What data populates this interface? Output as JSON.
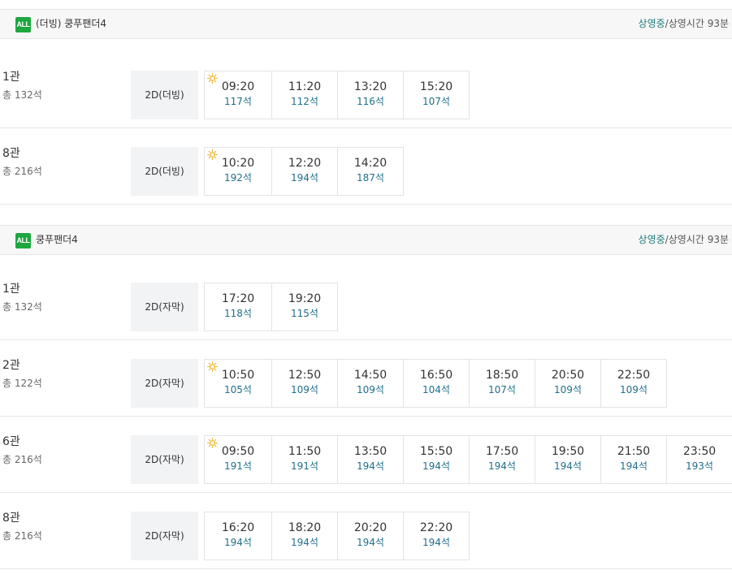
{
  "movies": [
    {
      "rating": "ALL",
      "title": "(더빙) 쿵푸팬더4",
      "status_label": "상영중",
      "runtime": "/상영시간 93분",
      "halls": [
        {
          "name": "1관",
          "seats": "총 132석",
          "format": "2D(더빙)",
          "showtimes": [
            {
              "time": "09:20",
              "seats": "117석",
              "icon": "sun-icon"
            },
            {
              "time": "11:20",
              "seats": "112석"
            },
            {
              "time": "13:20",
              "seats": "116석"
            },
            {
              "time": "15:20",
              "seats": "107석"
            }
          ]
        },
        {
          "name": "8관",
          "seats": "총 216석",
          "format": "2D(더빙)",
          "showtimes": [
            {
              "time": "10:20",
              "seats": "192석",
              "icon": "sun-icon"
            },
            {
              "time": "12:20",
              "seats": "194석"
            },
            {
              "time": "14:20",
              "seats": "187석"
            }
          ]
        }
      ]
    },
    {
      "rating": "ALL",
      "title": "쿵푸팬더4",
      "status_label": "상영중",
      "runtime": "/상영시간 93분",
      "halls": [
        {
          "name": "1관",
          "seats": "총 132석",
          "format": "2D(자막)",
          "showtimes": [
            {
              "time": "17:20",
              "seats": "118석"
            },
            {
              "time": "19:20",
              "seats": "115석"
            }
          ]
        },
        {
          "name": "2관",
          "seats": "총 122석",
          "format": "2D(자막)",
          "showtimes": [
            {
              "time": "10:50",
              "seats": "105석",
              "icon": "sun-icon"
            },
            {
              "time": "12:50",
              "seats": "109석"
            },
            {
              "time": "14:50",
              "seats": "109석"
            },
            {
              "time": "16:50",
              "seats": "104석"
            },
            {
              "time": "18:50",
              "seats": "107석"
            },
            {
              "time": "20:50",
              "seats": "109석"
            },
            {
              "time": "22:50",
              "seats": "109석"
            }
          ]
        },
        {
          "name": "6관",
          "seats": "총 216석",
          "format": "2D(자막)",
          "showtimes": [
            {
              "time": "09:50",
              "seats": "191석",
              "icon": "sun-icon"
            },
            {
              "time": "11:50",
              "seats": "191석"
            },
            {
              "time": "13:50",
              "seats": "194석"
            },
            {
              "time": "15:50",
              "seats": "194석"
            },
            {
              "time": "17:50",
              "seats": "194석"
            },
            {
              "time": "19:50",
              "seats": "194석"
            },
            {
              "time": "21:50",
              "seats": "194석"
            },
            {
              "time": "23:50",
              "seats": "193석"
            }
          ]
        },
        {
          "name": "8관",
          "seats": "총 216석",
          "format": "2D(자막)",
          "showtimes": [
            {
              "time": "16:20",
              "seats": "194석"
            },
            {
              "time": "18:20",
              "seats": "194석"
            },
            {
              "time": "20:20",
              "seats": "194석"
            },
            {
              "time": "22:20",
              "seats": "194석"
            }
          ]
        }
      ]
    }
  ],
  "colors": {
    "badge": "#1ea63f",
    "status": "#1f7a7a",
    "seat_count": "#1f6f8b",
    "sun_icon": "#f0b429"
  }
}
